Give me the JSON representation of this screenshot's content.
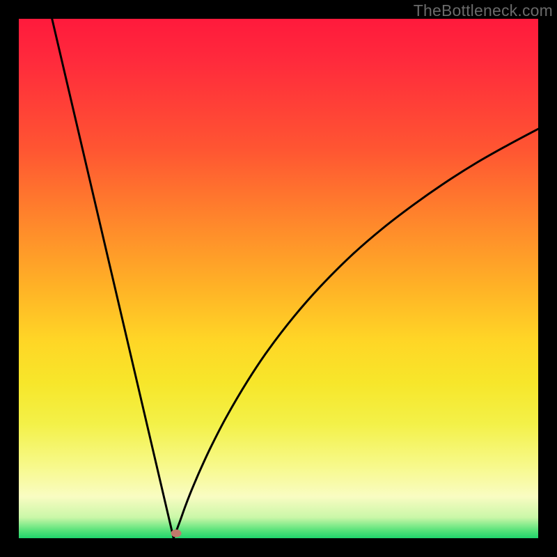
{
  "watermark": "TheBottleneck.com",
  "chart_data": {
    "type": "line",
    "title": "",
    "xlabel": "",
    "ylabel": "",
    "xlim": [
      0,
      100
    ],
    "ylim": [
      0,
      100
    ],
    "left_branch": {
      "x": [
        6.4,
        29.8
      ],
      "y": [
        100,
        0
      ]
    },
    "right_branch": {
      "name": "bottleneck-curve-right",
      "x": [
        29.8,
        31,
        32,
        33,
        34,
        35,
        37,
        40,
        44,
        48,
        53,
        58,
        64,
        70,
        76,
        82,
        88,
        94,
        100
      ],
      "y": [
        0,
        3.2,
        6.0,
        8.6,
        11.0,
        13.3,
        17.6,
        23.4,
        30.2,
        36.2,
        42.7,
        48.4,
        54.4,
        59.6,
        64.2,
        68.4,
        72.2,
        75.6,
        78.8
      ]
    },
    "marker": {
      "x": 30.3,
      "y": 0.9,
      "color": "#c07a6c"
    },
    "gradient_colors": {
      "top": "#ff1a3c",
      "mid": "#ffd626",
      "bottom": "#20d56c"
    }
  }
}
